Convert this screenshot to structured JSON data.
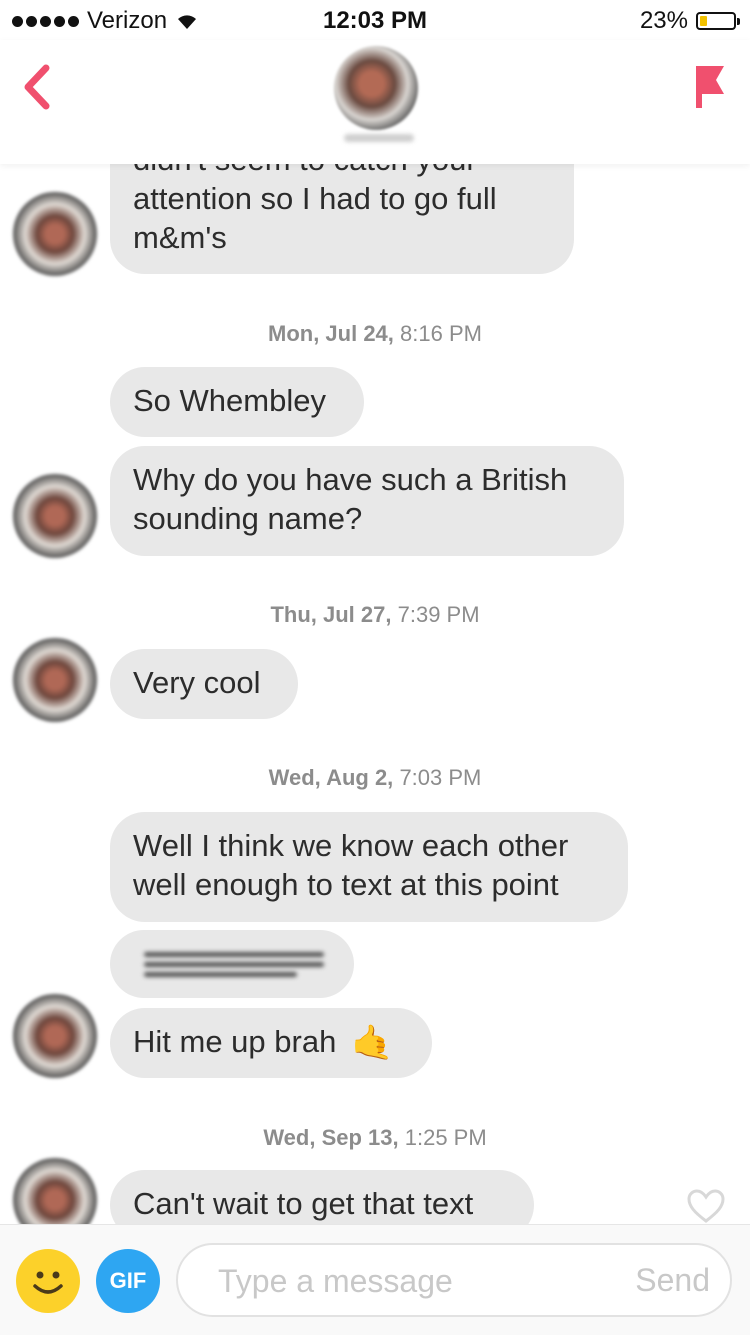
{
  "status_bar": {
    "carrier": "Verizon",
    "time": "12:03 PM",
    "battery_percent": "23%",
    "battery_level": 0.23
  },
  "header": {
    "back_icon": "chevron-left-icon",
    "report_icon": "flag-icon",
    "accent_color": "#f0506e"
  },
  "messages": [
    {
      "lines": [
        "didn't seem to catch your",
        "attention so I had to go full",
        "m&m's"
      ]
    },
    {
      "timestamp_day": "Mon, Jul 24,",
      "timestamp_time": "8:16 PM"
    },
    {
      "text": "So Whembley"
    },
    {
      "lines": [
        "Why do you have such a British",
        "sounding name?"
      ]
    },
    {
      "timestamp_day": "Thu, Jul 27,",
      "timestamp_time": "7:39 PM"
    },
    {
      "text": "Very cool"
    },
    {
      "timestamp_day": "Wed, Aug 2,",
      "timestamp_time": "7:03 PM"
    },
    {
      "lines": [
        "Well I think we know each other",
        "well enough to text at this point"
      ]
    },
    {
      "text": "Hit me up brah",
      "emoji": "🤙"
    },
    {
      "timestamp_day": "Wed, Sep 13,",
      "timestamp_time": "1:25 PM"
    },
    {
      "text": "Can't wait to get that text"
    }
  ],
  "composer": {
    "gif_label": "GIF",
    "placeholder": "Type a message",
    "send_label": "Send",
    "emoji_button_color": "#fcd12a",
    "gif_button_color": "#2ea6f2"
  }
}
